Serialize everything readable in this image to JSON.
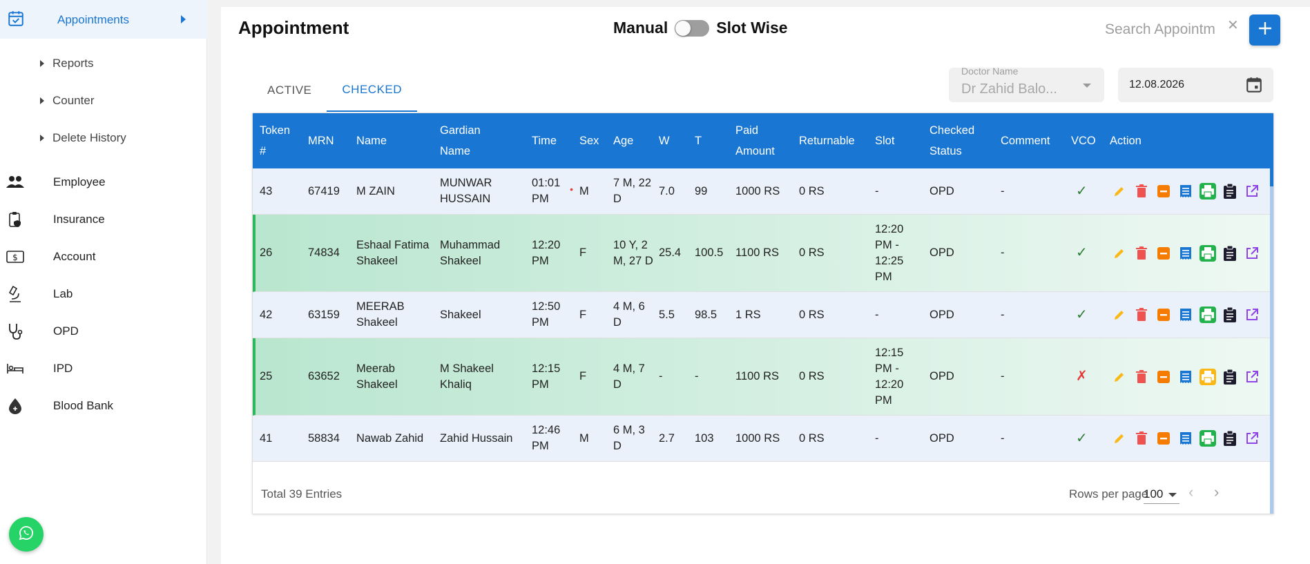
{
  "sidebar": {
    "active": {
      "label": "Appointments",
      "icon": "calendar-check-icon"
    },
    "subitems": [
      {
        "label": "Reports"
      },
      {
        "label": "Counter"
      },
      {
        "label": "Delete History"
      }
    ],
    "items": [
      {
        "label": "Employee",
        "icon": "people-icon"
      },
      {
        "label": "Insurance",
        "icon": "clipboard-shield-icon"
      },
      {
        "label": "Account",
        "icon": "dollar-bill-icon"
      },
      {
        "label": "Lab",
        "icon": "microscope-icon"
      },
      {
        "label": "OPD",
        "icon": "stethoscope-icon"
      },
      {
        "label": "IPD",
        "icon": "bed-icon"
      },
      {
        "label": "Blood Bank",
        "icon": "blood-drop-icon"
      }
    ]
  },
  "header": {
    "title": "Appointment",
    "mode_left": "Manual",
    "mode_right": "Slot Wise",
    "search_placeholder": "Search Appointment",
    "clear_symbol": "✕",
    "add_label": "+"
  },
  "tabs": [
    {
      "label": "ACTIVE",
      "active": false
    },
    {
      "label": "CHECKED",
      "active": true
    }
  ],
  "filters": {
    "doctor_label": "Doctor Name",
    "doctor_value": "Dr Zahid Balo...",
    "date_value": "12.08.2026"
  },
  "table": {
    "columns": [
      {
        "key": "token",
        "label": "Token #"
      },
      {
        "key": "mrn",
        "label": "MRN"
      },
      {
        "key": "name",
        "label": "Name"
      },
      {
        "key": "guardian",
        "label": "Gardian Name"
      },
      {
        "key": "time",
        "label": "Time"
      },
      {
        "key": "sex",
        "label": "Sex"
      },
      {
        "key": "age",
        "label": "Age"
      },
      {
        "key": "w",
        "label": "W"
      },
      {
        "key": "t",
        "label": "T"
      },
      {
        "key": "paid",
        "label": "Paid Amount"
      },
      {
        "key": "returnable",
        "label": "Returnable"
      },
      {
        "key": "slot",
        "label": "Slot"
      },
      {
        "key": "status",
        "label": "Checked Status"
      },
      {
        "key": "comment",
        "label": "Comment"
      },
      {
        "key": "vco",
        "label": "VCO"
      },
      {
        "key": "action",
        "label": "Action"
      }
    ],
    "rows": [
      {
        "token": "43",
        "mrn": "67419",
        "name": "M ZAIN",
        "guardian": "MUNWAR HUSSAIN",
        "time": "01:01 PM",
        "time_flag": "•",
        "sex": "M",
        "age": "7 M, 22 D",
        "w": "7.0",
        "t": "99",
        "paid": "1000 RS",
        "returnable": "0 RS",
        "slot": "-",
        "status": "OPD",
        "comment": "-",
        "vco": "✓",
        "print_color": "#21b24b",
        "highlight": false
      },
      {
        "token": "26",
        "mrn": "74834",
        "name": "Eshaal Fatima Shakeel",
        "guardian": "Muhammad Shakeel",
        "time": "12:20 PM",
        "time_flag": "",
        "sex": "F",
        "age": "10 Y, 2 M, 27 D",
        "w": "25.4",
        "t": "100.5",
        "paid": "1100 RS",
        "returnable": "0 RS",
        "slot": "12:20 PM - 12:25 PM",
        "status": "OPD",
        "comment": "-",
        "vco": "✓",
        "print_color": "#21b24b",
        "highlight": true
      },
      {
        "token": "42",
        "mrn": "63159",
        "name": "MEERAB Shakeel",
        "guardian": "Shakeel",
        "time": "12:50 PM",
        "time_flag": "",
        "sex": "F",
        "age": "4 M, 6 D",
        "w": "5.5",
        "t": "98.5",
        "paid": "1 RS",
        "returnable": "0 RS",
        "slot": "-",
        "status": "OPD",
        "comment": "-",
        "vco": "✓",
        "print_color": "#21b24b",
        "highlight": false
      },
      {
        "token": "25",
        "mrn": "63652",
        "name": "Meerab Shakeel",
        "guardian": "M Shakeel Khaliq",
        "time": "12:15 PM",
        "time_flag": "",
        "sex": "F",
        "age": "4 M, 7 D",
        "w": "-",
        "t": "-",
        "paid": "1100 RS",
        "returnable": "0 RS",
        "slot": "12:15 PM - 12:20 PM",
        "status": "OPD",
        "comment": "-",
        "vco": "✗",
        "print_color": "#f9b815",
        "highlight": true
      },
      {
        "token": "41",
        "mrn": "58834",
        "name": "Nawab Zahid",
        "guardian": "Zahid Hussain",
        "time": "12:46 PM",
        "time_flag": "",
        "sex": "M",
        "age": "6 M, 3 D",
        "w": "2.7",
        "t": "103",
        "paid": "1000 RS",
        "returnable": "0 RS",
        "slot": "-",
        "status": "OPD",
        "comment": "-",
        "vco": "✓",
        "print_color": "#21b24b",
        "highlight": false
      }
    ]
  },
  "footer": {
    "total": "Total 39 Entries",
    "rows_per_page_label": "Rows per page",
    "rows_per_page": "100"
  },
  "colors": {
    "primary": "#1976d2",
    "highlight_row": "#c4ead6",
    "highlight_border": "#2eb85c"
  }
}
